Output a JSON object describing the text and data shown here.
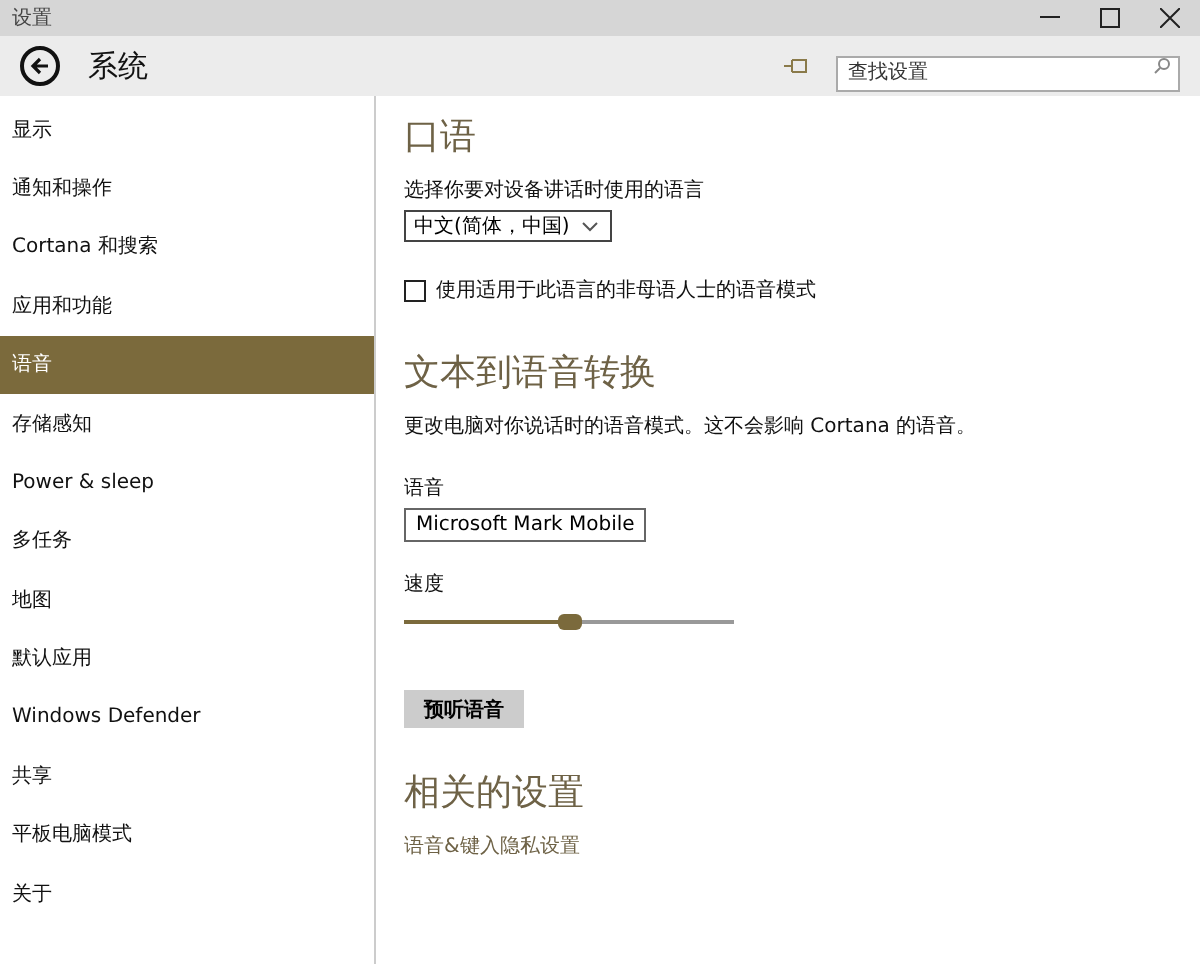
{
  "window": {
    "title": "设置"
  },
  "header": {
    "title": "系统",
    "search": {
      "placeholder": "查找设置"
    }
  },
  "sidebar": {
    "items": [
      {
        "label": "显示",
        "selected": false
      },
      {
        "label": "通知和操作",
        "selected": false
      },
      {
        "label": "Cortana 和搜索",
        "selected": false
      },
      {
        "label": "应用和功能",
        "selected": false
      },
      {
        "label": "语音",
        "selected": true
      },
      {
        "label": "存储感知",
        "selected": false
      },
      {
        "label": "Power & sleep",
        "selected": false
      },
      {
        "label": "多任务",
        "selected": false
      },
      {
        "label": "地图",
        "selected": false
      },
      {
        "label": "默认应用",
        "selected": false
      },
      {
        "label": "Windows Defender",
        "selected": false
      },
      {
        "label": "共享",
        "selected": false
      },
      {
        "label": "平板电脑模式",
        "selected": false
      },
      {
        "label": "关于",
        "selected": false
      }
    ]
  },
  "speech": {
    "title": "口语",
    "language_label": "选择你要对设备讲话时使用的语言",
    "language_value": "中文(简体，中国)",
    "non_native": {
      "label": "使用适用于此语言的非母语人士的语音模式",
      "checked": false
    }
  },
  "tts": {
    "title": "文本到语音转换",
    "description": "更改电脑对你说话时的语音模式。这不会影响 Cortana 的语音。",
    "voice_label": "语音",
    "voice_value": "Microsoft Mark Mobile",
    "speed_label": "速度",
    "speed": {
      "level": 0.5
    },
    "preview_button": "预听语音"
  },
  "related": {
    "title": "相关的设置",
    "link": "语音&键入隐私设置"
  }
}
